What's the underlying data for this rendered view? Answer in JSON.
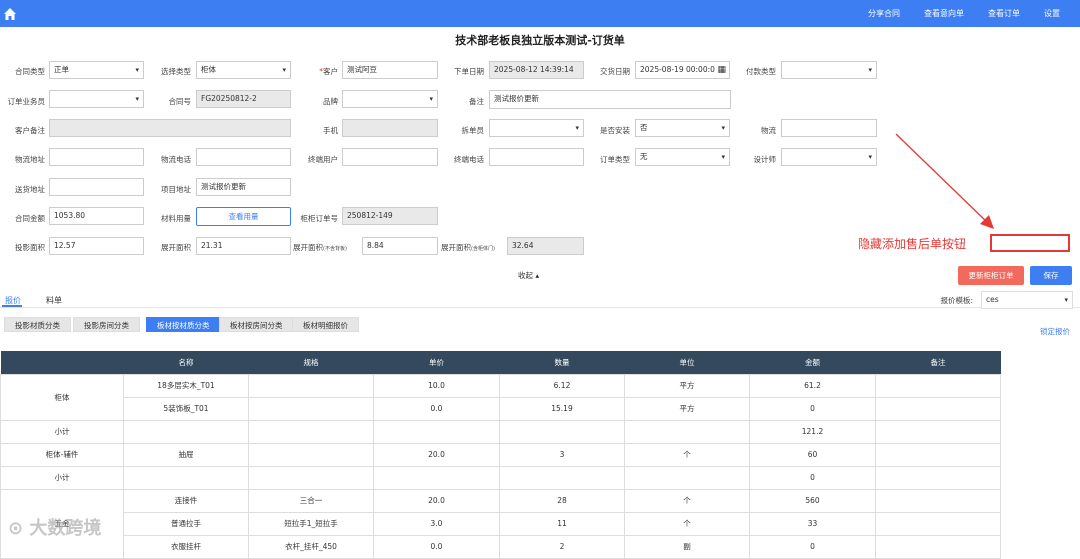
{
  "nav": {
    "links": [
      "分享合同",
      "查看意向单",
      "查看订单",
      "设置"
    ]
  },
  "page_title": "技术部老板良独立版本测试-订货单",
  "form": {
    "contract_type_label": "合同类型",
    "contract_type": "正单",
    "select_type_label": "选择类型",
    "select_type": "柜体",
    "customer_label": "客户",
    "customer": "测试阿豆",
    "order_date_label": "下单日期",
    "order_date": "2025-08-12 14:39:14",
    "delivery_date_label": "交货日期",
    "delivery_date": "2025-08-19 00:00:0",
    "payment_type_label": "付款类型",
    "payment_type": "",
    "salesman_label": "订单业务员",
    "salesman": "",
    "contract_no_label": "合同号",
    "contract_no": "FG20250812-2",
    "brand_label": "品牌",
    "brand": "",
    "remark_label": "备注",
    "remark": "测试报价更新",
    "customer_remark_label": "客户备注",
    "customer_remark": "",
    "phone_label": "手机",
    "phone": "",
    "disassembler_label": "拆单员",
    "disassembler": "",
    "install_label": "是否安装",
    "install": "否",
    "logistics_label": "物流",
    "logistics": "",
    "logistics_addr_label": "物流地址",
    "logistics_addr": "",
    "logistics_phone_label": "物流电话",
    "logistics_phone": "",
    "end_user_label": "终端用户",
    "end_user": "",
    "end_phone_label": "终端电话",
    "end_phone": "",
    "order_type_label": "订单类型",
    "order_type": "无",
    "designer_label": "设计师",
    "designer": "",
    "delivery_addr_label": "送货地址",
    "delivery_addr": "",
    "project_addr_label": "项目地址",
    "project_addr": "测试报价更新",
    "amount_label": "合同金额",
    "amount": "1053.80",
    "material_label": "材料用量",
    "material_btn": "查看用量",
    "cabinet_order_label": "柜柜订单号",
    "cabinet_order": "250812-149",
    "proj_area_label": "投影面积",
    "proj_area": "12.57",
    "unfold_area_label": "展开面积",
    "unfold_area": "21.31",
    "unfold_area2_label": "展开面积",
    "unfold_area2_note": "(不含背板)",
    "unfold_area2": "8.84",
    "unfold_area3_label": "展开面积",
    "unfold_area3_note": "(含柜体门)",
    "unfold_area3": "32.64"
  },
  "collapse": "收起",
  "buttons": {
    "update": "更新柜柜订单",
    "save": "保存"
  },
  "tabs": [
    "报价",
    "料单"
  ],
  "template_label": "报价模板:",
  "template": "ces",
  "categories": [
    "投影材质分类",
    "投影房间分类",
    "板材按材质分类",
    "板材按房间分类",
    "板材明细报价"
  ],
  "lock_quote": "锁定报价",
  "table": {
    "headers": [
      "",
      "名称",
      "规格",
      "单价",
      "数量",
      "单位",
      "金额",
      "备注"
    ],
    "rows": [
      [
        "柜体",
        "18多层实木_T01",
        "",
        "10.0",
        "6.12",
        "平方",
        "61.2",
        ""
      ],
      [
        "",
        "5装饰板_T01",
        "",
        "0.0",
        "15.19",
        "平方",
        "0",
        ""
      ],
      [
        "小计",
        "",
        "",
        "",
        "",
        "",
        "121.2",
        ""
      ],
      [
        "柜体-辅件",
        "抽屉",
        "",
        "20.0",
        "3",
        "个",
        "60",
        ""
      ],
      [
        "小计",
        "",
        "",
        "",
        "",
        "",
        "0",
        ""
      ],
      [
        "",
        "连接件",
        "三合一",
        "20.0",
        "28",
        "个",
        "560",
        ""
      ],
      [
        "五金",
        "普通拉手",
        "短拉手1_短拉手",
        "3.0",
        "11",
        "个",
        "33",
        ""
      ],
      [
        "",
        "衣服挂杆",
        "衣杆_挂杆_450",
        "0.0",
        "2",
        "副",
        "0",
        ""
      ]
    ]
  },
  "annotation": "隐藏添加售后单按钮",
  "watermark": "大数跨境"
}
